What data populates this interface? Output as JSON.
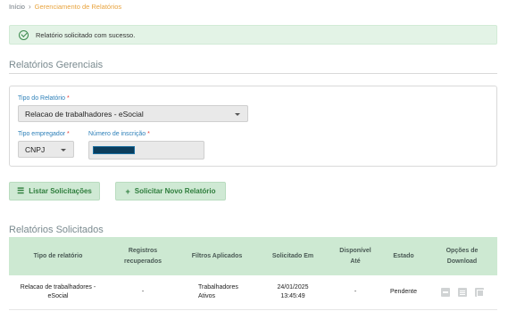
{
  "breadcrumb": {
    "home": "Início",
    "separator": "›",
    "current": "Gerenciamento de Relatórios"
  },
  "alert": {
    "message": "Relatório solicitado com sucesso.",
    "icon": "check-circle-icon"
  },
  "section1": {
    "title": "Relatórios Gerenciais"
  },
  "form": {
    "tipo_relatorio": {
      "label": "Tipo do Relatório",
      "required": "*",
      "value": "Relacao de trabalhadores - eSocial"
    },
    "tipo_empregador": {
      "label": "Tipo empregador",
      "required": "*",
      "value": "CNPJ"
    },
    "numero_inscricao": {
      "label": "Número de inscrição",
      "required": "*"
    }
  },
  "buttons": {
    "listar": {
      "icon": "☰",
      "label": "Listar Solicitações"
    },
    "solicitar": {
      "icon": "+",
      "label": "Solicitar Novo Relatório"
    }
  },
  "section2": {
    "title": "Relatórios Solicitados"
  },
  "table": {
    "headers": {
      "tipo": "Tipo de relatório",
      "registros_1": "Registros",
      "registros_2": "recuperados",
      "filtros": "Filtros Aplicados",
      "solicitado": "Solicitado Em",
      "disponivel_1": "Disponível",
      "disponivel_2": "Até",
      "estado": "Estado",
      "opcoes_1": "Opções de",
      "opcoes_2": "Download"
    },
    "rows": [
      {
        "tipo_1": "Relacao de trabalhadores -",
        "tipo_2": "eSocial",
        "registros": "-",
        "filtros_1": "Trabalhadores",
        "filtros_2": "Ativos",
        "data": "24/01/2025",
        "hora": "13:45:49",
        "disponivel": "-",
        "estado": "Pendente"
      }
    ]
  }
}
